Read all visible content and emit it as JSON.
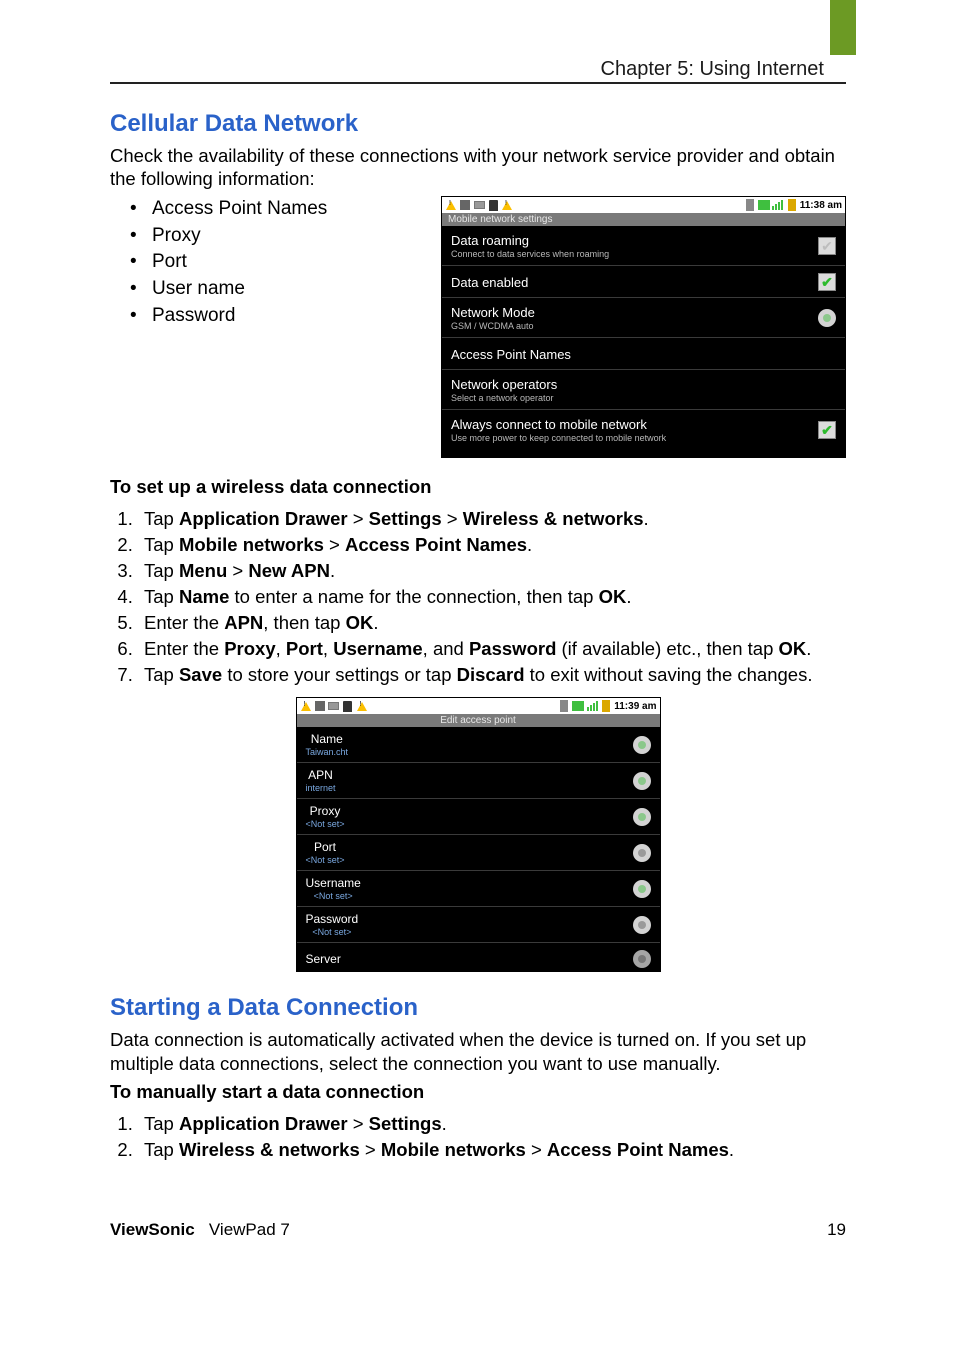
{
  "header": {
    "chapter": "Chapter 5: Using Internet"
  },
  "section1": {
    "title": "Cellular Data Network",
    "intro": "Check the availability of these connections with your network service provider and obtain the following information:",
    "bullets": [
      "Access Point Names",
      "Proxy",
      "Port",
      "User name",
      "Password"
    ]
  },
  "phone1": {
    "clock": "11:38 am",
    "subheader": "Mobile network settings",
    "rows": [
      {
        "title": "Data roaming",
        "sub": "Connect to data services when roaming",
        "ctrl": "chk-off"
      },
      {
        "title": "Data enabled",
        "sub": "",
        "ctrl": "chk-on"
      },
      {
        "title": "Network Mode",
        "sub": "GSM / WCDMA auto",
        "ctrl": "radio"
      },
      {
        "title": "Access Point Names",
        "sub": "",
        "ctrl": ""
      },
      {
        "title": "Network operators",
        "sub": "Select a network operator",
        "ctrl": ""
      },
      {
        "title": "Always connect to mobile network",
        "sub": "Use more power to keep connected to mobile network",
        "ctrl": "chk-on"
      }
    ]
  },
  "setup": {
    "heading": "To set up a wireless data connection",
    "steps": {
      "s1a": "Tap ",
      "s1b": "Application Drawer",
      "s1c": " > ",
      "s1d": "Settings",
      "s1e": " > ",
      "s1f": "Wireless & networks",
      "s1g": ".",
      "s2a": "Tap ",
      "s2b": "Mobile networks",
      "s2c": " > ",
      "s2d": "Access Point Names",
      "s2e": ".",
      "s3a": "Tap ",
      "s3b": "Menu",
      "s3c": " > ",
      "s3d": "New APN",
      "s3e": ".",
      "s4a": "Tap ",
      "s4b": "Name",
      "s4c": " to enter a name for the connection, then tap ",
      "s4d": "OK",
      "s4e": ".",
      "s5a": "Enter the ",
      "s5b": "APN",
      "s5c": ", then tap ",
      "s5d": "OK",
      "s5e": ".",
      "s6a": "Enter the ",
      "s6b": "Proxy",
      "s6c": ", ",
      "s6d": "Port",
      "s6e": ", ",
      "s6f": "Username",
      "s6g": ", and ",
      "s6h": "Password",
      "s6i": " (if available) etc., then tap ",
      "s6j": "OK",
      "s6k": ".",
      "s7a": "Tap ",
      "s7b": "Save",
      "s7c": " to store your settings or tap ",
      "s7d": "Discard",
      "s7e": " to exit without saving the changes."
    }
  },
  "phone2": {
    "clock": "11:39 am",
    "subheader": "Edit access point",
    "rows": [
      {
        "title": "Name",
        "sub": "Taiwan.cht"
      },
      {
        "title": "APN",
        "sub": "internet"
      },
      {
        "title": "Proxy",
        "sub": "<Not set>"
      },
      {
        "title": "Port",
        "sub": "<Not set>"
      },
      {
        "title": "Username",
        "sub": "<Not set>"
      },
      {
        "title": "Password",
        "sub": "<Not set>"
      },
      {
        "title": "Server",
        "sub": ""
      }
    ]
  },
  "section2": {
    "title": "Starting a Data Connection",
    "intro": "Data connection is automatically activated when the device is turned on. If you set up multiple data connections, select the connection you want to use manually.",
    "heading": "To manually start a data connection",
    "steps": {
      "s1a": "Tap ",
      "s1b": "Application Drawer",
      "s1c": " > ",
      "s1d": "Settings",
      "s1e": ".",
      "s2a": "Tap ",
      "s2b": "Wireless & networks",
      "s2c": " > ",
      "s2d": "Mobile networks",
      "s2e": " > ",
      "s2f": "Access Point Names",
      "s2g": "."
    }
  },
  "footer": {
    "brand_bold": "ViewSonic",
    "brand_rest": "ViewPad 7",
    "page": "19"
  }
}
